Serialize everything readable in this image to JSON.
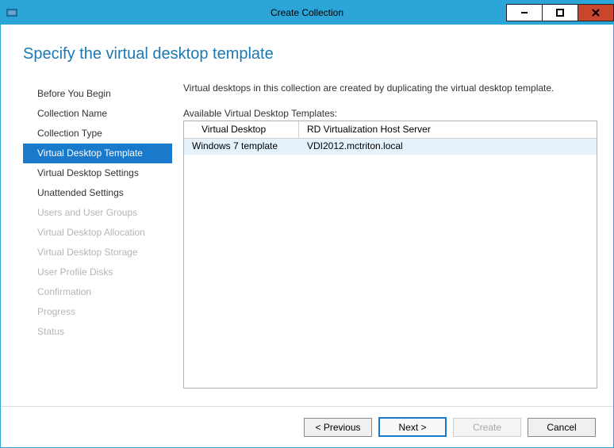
{
  "window": {
    "title": "Create Collection"
  },
  "page": {
    "heading": "Specify the virtual desktop template",
    "description": "Virtual desktops in this collection are created by duplicating the virtual desktop template.",
    "table_label": "Available Virtual Desktop Templates:"
  },
  "sidebar": {
    "items": [
      {
        "label": "Before You Begin",
        "state": "enabled"
      },
      {
        "label": "Collection Name",
        "state": "enabled"
      },
      {
        "label": "Collection Type",
        "state": "enabled"
      },
      {
        "label": "Virtual Desktop Template",
        "state": "selected"
      },
      {
        "label": "Virtual Desktop Settings",
        "state": "enabled"
      },
      {
        "label": "Unattended Settings",
        "state": "enabled"
      },
      {
        "label": "Users and User Groups",
        "state": "disabled"
      },
      {
        "label": "Virtual Desktop Allocation",
        "state": "disabled"
      },
      {
        "label": "Virtual Desktop Storage",
        "state": "disabled"
      },
      {
        "label": "User Profile Disks",
        "state": "disabled"
      },
      {
        "label": "Confirmation",
        "state": "disabled"
      },
      {
        "label": "Progress",
        "state": "disabled"
      },
      {
        "label": "Status",
        "state": "disabled"
      }
    ]
  },
  "table": {
    "columns": [
      "Virtual Desktop",
      "RD Virtualization Host Server"
    ],
    "rows": [
      {
        "vd": "Windows 7 template",
        "host": "VDI2012.mctriton.local",
        "selected": true
      }
    ]
  },
  "footer": {
    "previous": "< Previous",
    "next": "Next >",
    "create": "Create",
    "cancel": "Cancel"
  }
}
